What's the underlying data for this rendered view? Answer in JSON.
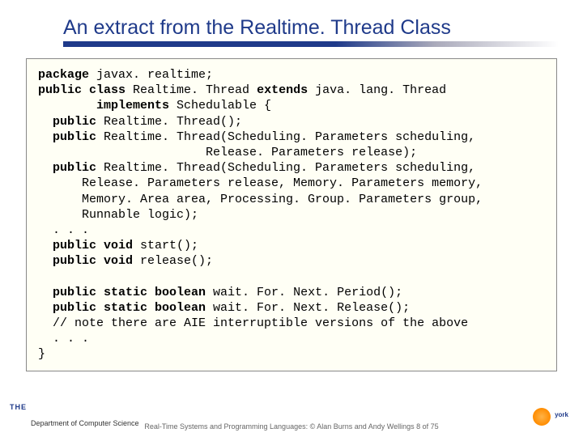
{
  "title": "An extract from the Realtime. Thread Class",
  "code": {
    "l1a": "package",
    "l1b": " javax. realtime;",
    "l2a": "public class",
    "l2b": " Realtime. Thread ",
    "l2c": "extends",
    "l2d": " java. lang. Thread",
    "l3a": "        implements",
    "l3b": " Schedulable {",
    "l4a": "  public",
    "l4b": " Realtime. Thread();",
    "l5a": "  public",
    "l5b": " Realtime. Thread(Scheduling. Parameters scheduling,",
    "l6": "                       Release. Parameters release);",
    "l7a": "  public",
    "l7b": " Realtime. Thread(Scheduling. Parameters scheduling,",
    "l8": "      Release. Parameters release, Memory. Parameters memory,",
    "l9": "      Memory. Area area, Processing. Group. Parameters group,",
    "l10": "      Runnable logic);",
    "l11": "  . . .",
    "l12a": "  public void",
    "l12b": " start();",
    "l13a": "  public void",
    "l13b": " release();",
    "blank": "",
    "l14a": "  public static boolean",
    "l14b": " wait. For. Next. Period();",
    "l15a": "  public static boolean",
    "l15b": " wait. For. Next. Release();",
    "l16": "  // note there are AIE interruptible versions of the above",
    "l17": "  . . .",
    "l18": "}"
  },
  "footer": "Real-Time Systems and Programming Languages: © Alan Burns and Andy Wellings 8 of 75",
  "the": "THE",
  "dept": "Department of Computer Science",
  "logo_txt": "york"
}
